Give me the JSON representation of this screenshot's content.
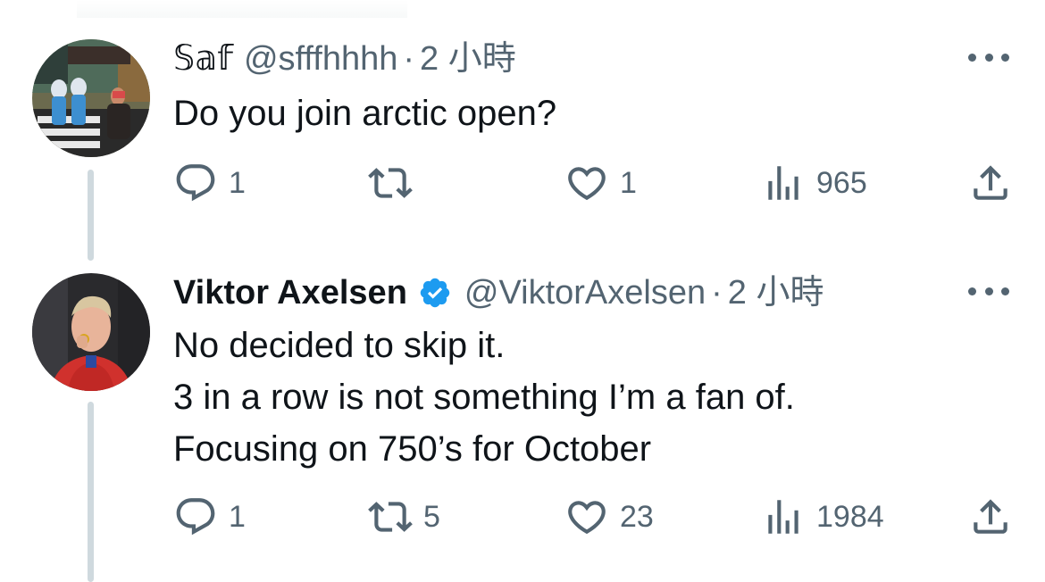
{
  "tweets": [
    {
      "display_name": "𝕊𝕒𝕗",
      "handle": "@sfffhhhh",
      "separator": "·",
      "time": "2 小時",
      "verified": false,
      "text_lines": [
        "Do you join arctic open?"
      ],
      "replies": "1",
      "retweets": "",
      "likes": "1",
      "views": "965"
    },
    {
      "display_name": "Viktor Axelsen",
      "handle": "@ViktorAxelsen",
      "separator": "·",
      "time": "2 小時",
      "verified": true,
      "text_lines": [
        "No decided to skip it.",
        "3 in a row is not something I’m a fan of.",
        "Focusing on 750’s for October"
      ],
      "replies": "1",
      "retweets": "5",
      "likes": "23",
      "views": "1984"
    }
  ],
  "icons": {
    "reply": "reply-icon",
    "retweet": "retweet-icon",
    "like": "heart-icon",
    "views": "views-icon",
    "share": "share-icon",
    "more": "more-icon",
    "verified": "verified-badge-icon"
  },
  "colors": {
    "text_primary": "#0f1419",
    "text_secondary": "#536471",
    "verified_blue": "#1d9bf0",
    "thread_line": "#cfd9de"
  }
}
